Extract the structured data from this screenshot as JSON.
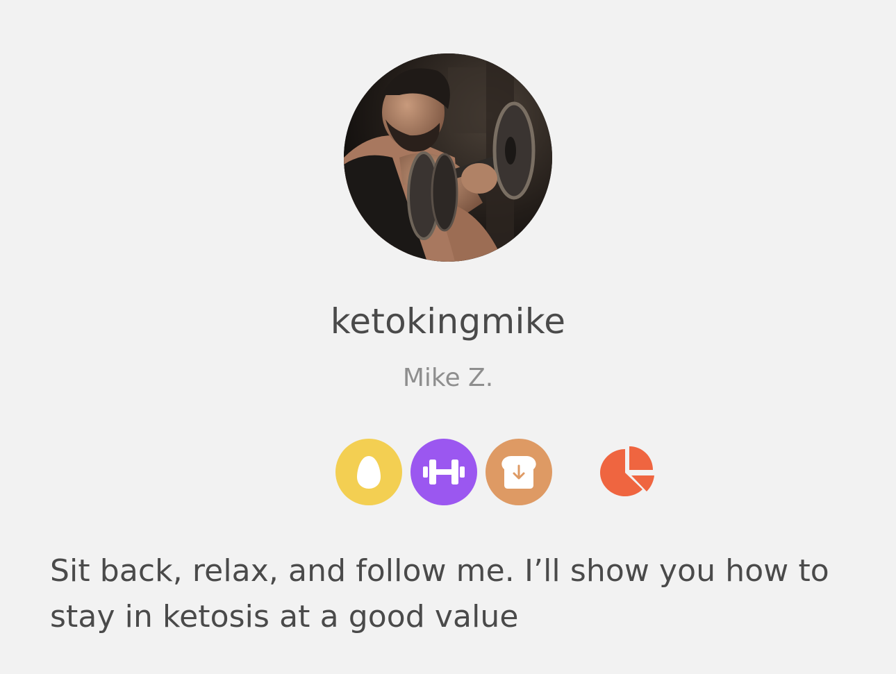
{
  "profile": {
    "username": "ketokingmike",
    "full_name": "Mike Z.",
    "bio": "Sit back, relax, and follow me. I’ll show you how to stay in ketosis at a good value"
  },
  "badges": [
    {
      "icon": "egg-icon",
      "color": "#f3cf52"
    },
    {
      "icon": "dumbbell-icon",
      "color": "#9b57f0"
    },
    {
      "icon": "bread-down-icon",
      "color": "#de9a64"
    }
  ],
  "macros": {
    "icon": "pie-chart-icon",
    "color": "#ef6540"
  }
}
